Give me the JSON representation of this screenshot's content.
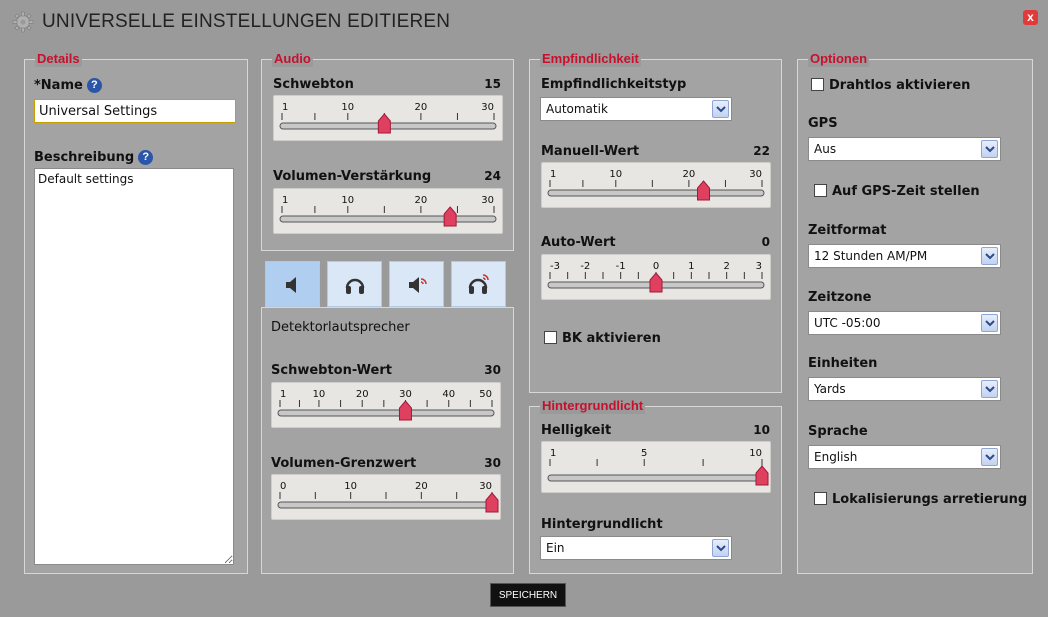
{
  "window": {
    "title": "UNIVERSELLE EINSTELLUNGEN EDITIEREN",
    "close_label": "x"
  },
  "details": {
    "legend": "Details",
    "name_label": "*Name",
    "name_value": "Universal Settings",
    "description_label": "Beschreibung",
    "description_value": "Default settings"
  },
  "audio": {
    "legend": "Audio",
    "schwebton": {
      "label": "Schwebton",
      "value": "15",
      "ticks": [
        "1",
        "10",
        "20",
        "30"
      ],
      "min": 1,
      "max": 30,
      "current": 15
    },
    "volumen": {
      "label": "Volumen-Verstärkung",
      "value": "24",
      "ticks": [
        "1",
        "10",
        "20",
        "30"
      ],
      "min": 1,
      "max": 30,
      "current": 24
    }
  },
  "tabs": [
    "speaker-icon",
    "headphones-icon",
    "speaker-wireless-icon",
    "headphones-wireless-icon"
  ],
  "detector": {
    "heading": "Detektorlautsprecher",
    "schwebton_wert": {
      "label": "Schwebton-Wert",
      "value": "30",
      "ticks": [
        "1",
        "10",
        "20",
        "30",
        "40",
        "50"
      ],
      "min": 1,
      "max": 50,
      "current": 30
    },
    "volumen_grenzwert": {
      "label": "Volumen-Grenzwert",
      "value": "30",
      "ticks": [
        "0",
        "10",
        "20",
        "30"
      ],
      "min": 0,
      "max": 30,
      "current": 30
    }
  },
  "empfindlichkeit": {
    "legend": "Empfindlichkeit",
    "type_label": "Empfindlichkeitstyp",
    "type_value": "Automatik",
    "manuell": {
      "label": "Manuell-Wert",
      "value": "22",
      "ticks": [
        "1",
        "10",
        "20",
        "30"
      ],
      "min": 1,
      "max": 30,
      "current": 22
    },
    "auto": {
      "label": "Auto-Wert",
      "value": "0",
      "ticks": [
        "-3",
        "-2",
        "-1",
        "0",
        "1",
        "2",
        "3"
      ],
      "min": -3,
      "max": 3,
      "current": 0
    },
    "bk_label": "BK aktivieren"
  },
  "hintergrundlicht": {
    "legend": "Hintergrundlicht",
    "helligkeit": {
      "label": "Helligkeit",
      "value": "10",
      "ticks": [
        "1",
        "5",
        "10"
      ],
      "min": 1,
      "max": 10,
      "current": 10
    },
    "select_label": "Hintergrundlicht",
    "select_value": "Ein"
  },
  "optionen": {
    "legend": "Optionen",
    "drahtlos_label": "Drahtlos aktivieren",
    "gps_label": "GPS",
    "gps_value": "Aus",
    "gps_zeit_label": "Auf GPS-Zeit stellen",
    "zeitformat_label": "Zeitformat",
    "zeitformat_value": "12 Stunden AM/PM",
    "zeitzone_label": "Zeitzone",
    "zeitzone_value": "UTC -05:00",
    "einheiten_label": "Einheiten",
    "einheiten_value": "Yards",
    "sprache_label": "Sprache",
    "sprache_value": "English",
    "lokalisierung_label": "Lokalisierungs arretierung"
  },
  "save_label": "SPEICHERN",
  "colors": {
    "legend": "#c8102e",
    "thumb": "#e04060",
    "help": "#2a55a8"
  }
}
